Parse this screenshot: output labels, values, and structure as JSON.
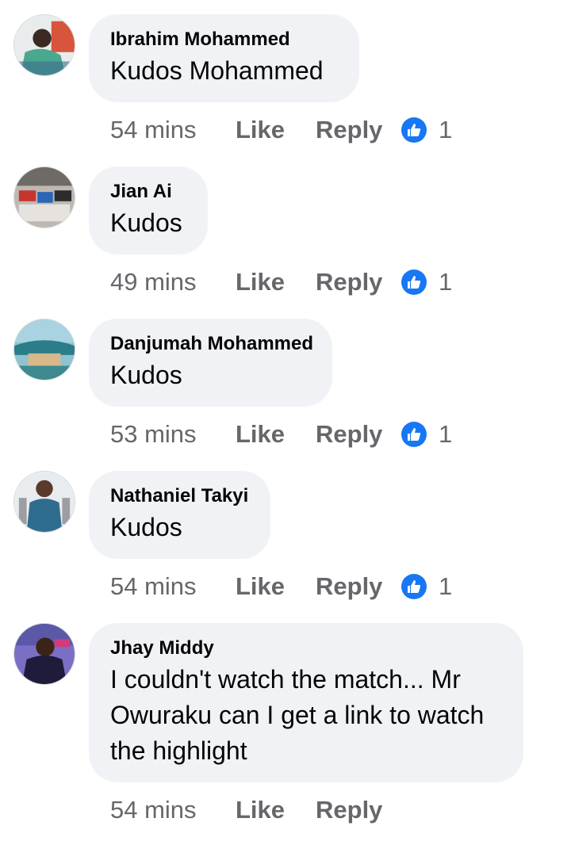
{
  "comments": [
    {
      "author": "Ibrahim Mohammed",
      "text": "Kudos Mohammed",
      "time": "54 mins",
      "like_label": "Like",
      "reply_label": "Reply",
      "reactions": "1",
      "avatar_color": "#5a8f7b"
    },
    {
      "author": "Jian Ai",
      "text": "Kudos",
      "time": "49 mins",
      "like_label": "Like",
      "reply_label": "Reply",
      "reactions": "1",
      "avatar_color": "#8c8a86"
    },
    {
      "author": "Danjumah Mohammed",
      "text": "Kudos",
      "time": "53 mins",
      "like_label": "Like",
      "reply_label": "Reply",
      "reactions": "1",
      "avatar_color": "#2f7f8e"
    },
    {
      "author": "Nathaniel Takyi",
      "text": "Kudos",
      "time": "54 mins",
      "like_label": "Like",
      "reply_label": "Reply",
      "reactions": "1",
      "avatar_color": "#9aa6b0"
    },
    {
      "author": "Jhay Middy",
      "text": "I couldn't watch the match... Mr Owuraku can I get a link to watch the highlight",
      "time": "54 mins",
      "like_label": "Like",
      "reply_label": "Reply",
      "reactions": "",
      "avatar_color": "#4a3f8f"
    }
  ],
  "colors": {
    "bubble": "#f0f2f5",
    "meta_text": "#65676b",
    "like_blue": "#1877f2"
  },
  "icons": {
    "reaction": "thumbs-up-icon"
  }
}
